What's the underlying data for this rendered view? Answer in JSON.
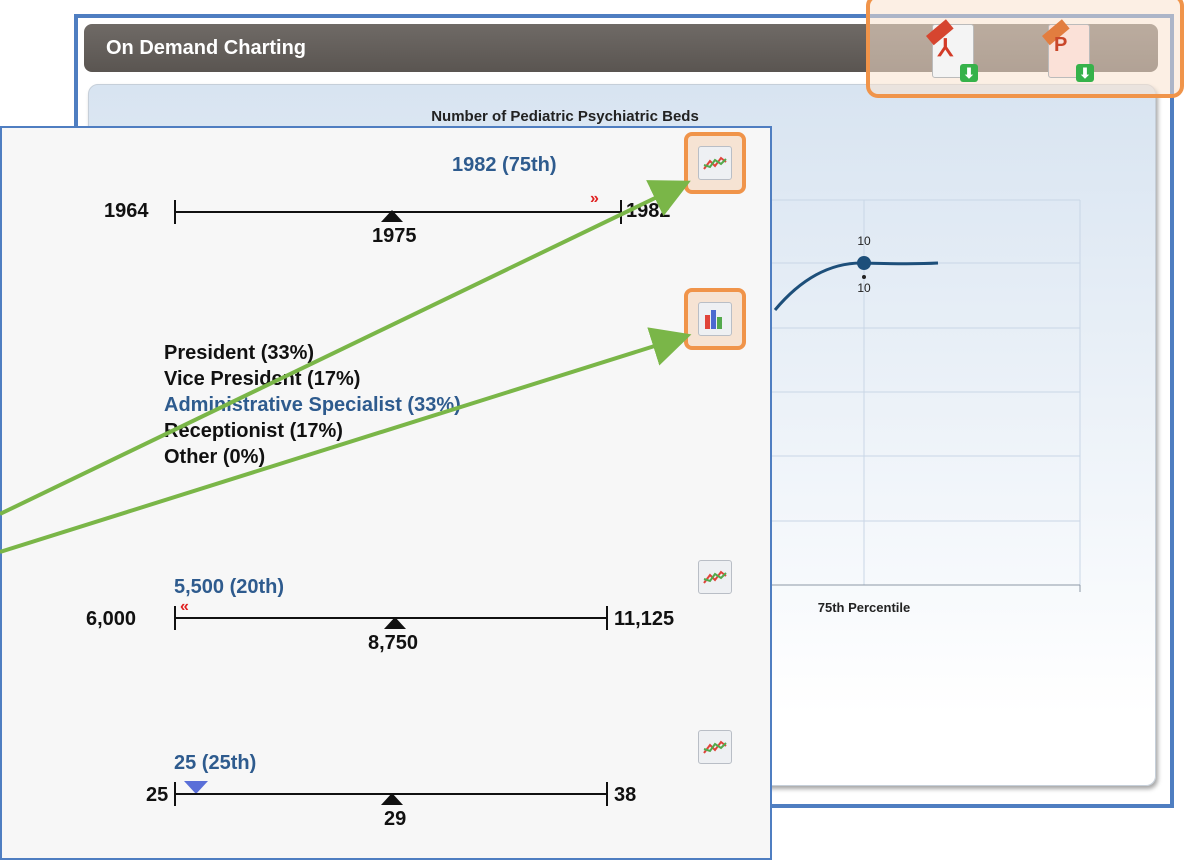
{
  "window": {
    "title": "On Demand Charting"
  },
  "export": {
    "pdf_icon": "pdf-icon",
    "ppt_icon": "powerpoint-icon"
  },
  "chart": {
    "title": "Number of Pediatric Psychiatric Beds",
    "category_label": "75th Percentile",
    "point_label_above": "10",
    "point_label_below": "10"
  },
  "chart_data": {
    "type": "line",
    "title": "Number of Pediatric Psychiatric Beds",
    "categories": [
      "75th Percentile"
    ],
    "series": [
      {
        "values": [
          10
        ]
      }
    ],
    "grid": true
  },
  "metrics": [
    {
      "min": "1964",
      "max": "1982",
      "median": "1975",
      "value_label": "1982 (75th)",
      "value_color": "#2e5b8e"
    },
    {
      "min": "6,000",
      "max": "11,125",
      "median": "8,750",
      "value_label": "5,500 (20th)",
      "value_color": "#2e5b8e"
    },
    {
      "min": "25",
      "max": "38",
      "median": "29",
      "value_label": "25 (25th)",
      "value_color": "#2e5b8e"
    }
  ],
  "roles": [
    {
      "label": "President (33%)",
      "color": "#111111"
    },
    {
      "label": "Vice President (17%)",
      "color": "#111111"
    },
    {
      "label": "Administrative Specialist (33%)",
      "color": "#2e5b8e"
    },
    {
      "label": "Receptionist (17%)",
      "color": "#111111"
    },
    {
      "label": "Other (0%)",
      "color": "#111111"
    }
  ],
  "icons": {
    "trend": "line-chart-icon",
    "bar": "bar-chart-icon"
  },
  "colors": {
    "border_blue": "#4f7ec1",
    "highlight_orange": "#f0944a",
    "arrow_green": "#7ab648",
    "marker_red": "#e02020"
  }
}
